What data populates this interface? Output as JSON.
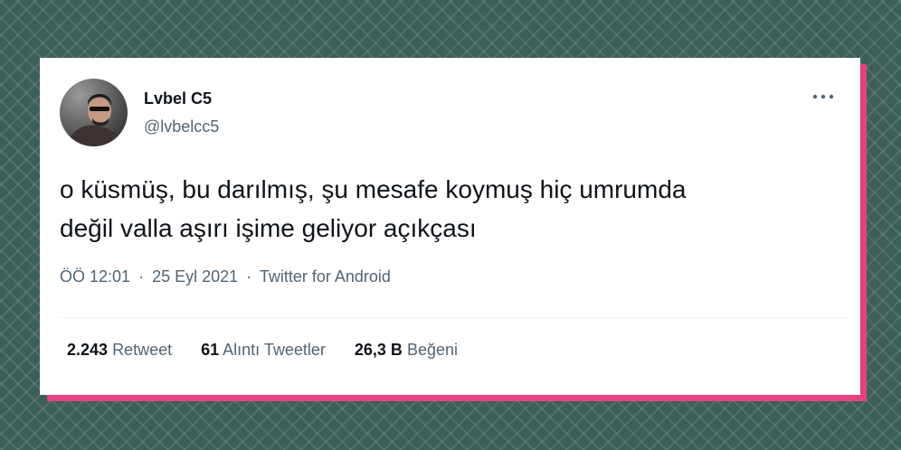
{
  "tweet": {
    "author": {
      "display_name": "Lvbel C5",
      "handle": "@lvbelcc5"
    },
    "text_line1": "o küsmüş, bu darılmış, şu mesafe koymuş hiç umrumda",
    "text_line2": "değil valla aşırı işime geliyor açıkçası",
    "time": "ÖÖ 12:01",
    "separator": "·",
    "date": "25 Eyl 2021",
    "source": "Twitter for Android",
    "stats": {
      "retweets_count": "2.243",
      "retweets_label": "Retweet",
      "quotes_count": "61",
      "quotes_label": "Alıntı Tweetler",
      "likes_count": "26,3 B",
      "likes_label": "Beğeni"
    }
  },
  "icons": {
    "more": "more-horizontal-icon",
    "avatar": "avatar-photo"
  },
  "colors": {
    "background": "#3d5f5a",
    "accent_shadow": "#e8417f",
    "card": "#ffffff",
    "primary_text": "#0f1419",
    "secondary_text": "#536471"
  }
}
